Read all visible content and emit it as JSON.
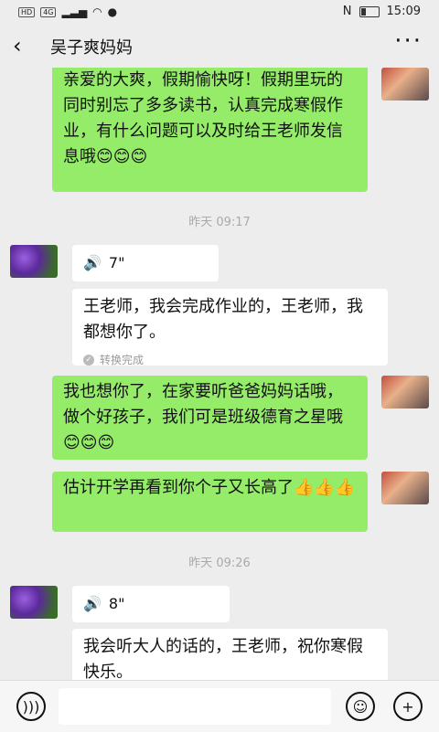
{
  "status_bar": {
    "left_badges": [
      "HD",
      "4G"
    ],
    "time": "15:09"
  },
  "header": {
    "back_icon": "chevron-left-icon",
    "title": "吴子爽妈妈",
    "more_icon": "ellipsis-icon"
  },
  "messages": [
    {
      "type": "text",
      "side": "self",
      "text": "亲爱的大爽，假期愉快呀！假期里玩的同时别忘了多多读书，认真完成寒假作业，有什么问题可以及时给王老师发信息哦😊😊😊"
    },
    {
      "type": "time",
      "text": "昨天 09:17"
    },
    {
      "type": "voice",
      "side": "other",
      "duration": "7\""
    },
    {
      "type": "converted",
      "side": "other",
      "text": "王老师，我会完成作业的，王老师，我都想你了。",
      "status": "转换完成"
    },
    {
      "type": "text",
      "side": "self",
      "text": "我也想你了，在家要听爸爸妈妈话哦，做个好孩子，我们可是班级德育之星哦😊😊😊"
    },
    {
      "type": "text",
      "side": "self",
      "text": "估计开学再看到你个子又长高了👍👍👍"
    },
    {
      "type": "time",
      "text": "昨天 09:26"
    },
    {
      "type": "voice",
      "side": "other",
      "duration": "8\""
    },
    {
      "type": "converted",
      "side": "other",
      "text": "我会听大人的话的，王老师，祝你寒假快乐。"
    }
  ],
  "footer": {
    "voice_icon": "voice-icon",
    "emoji_icon": "emoji-icon",
    "plus_icon": "plus-icon"
  }
}
